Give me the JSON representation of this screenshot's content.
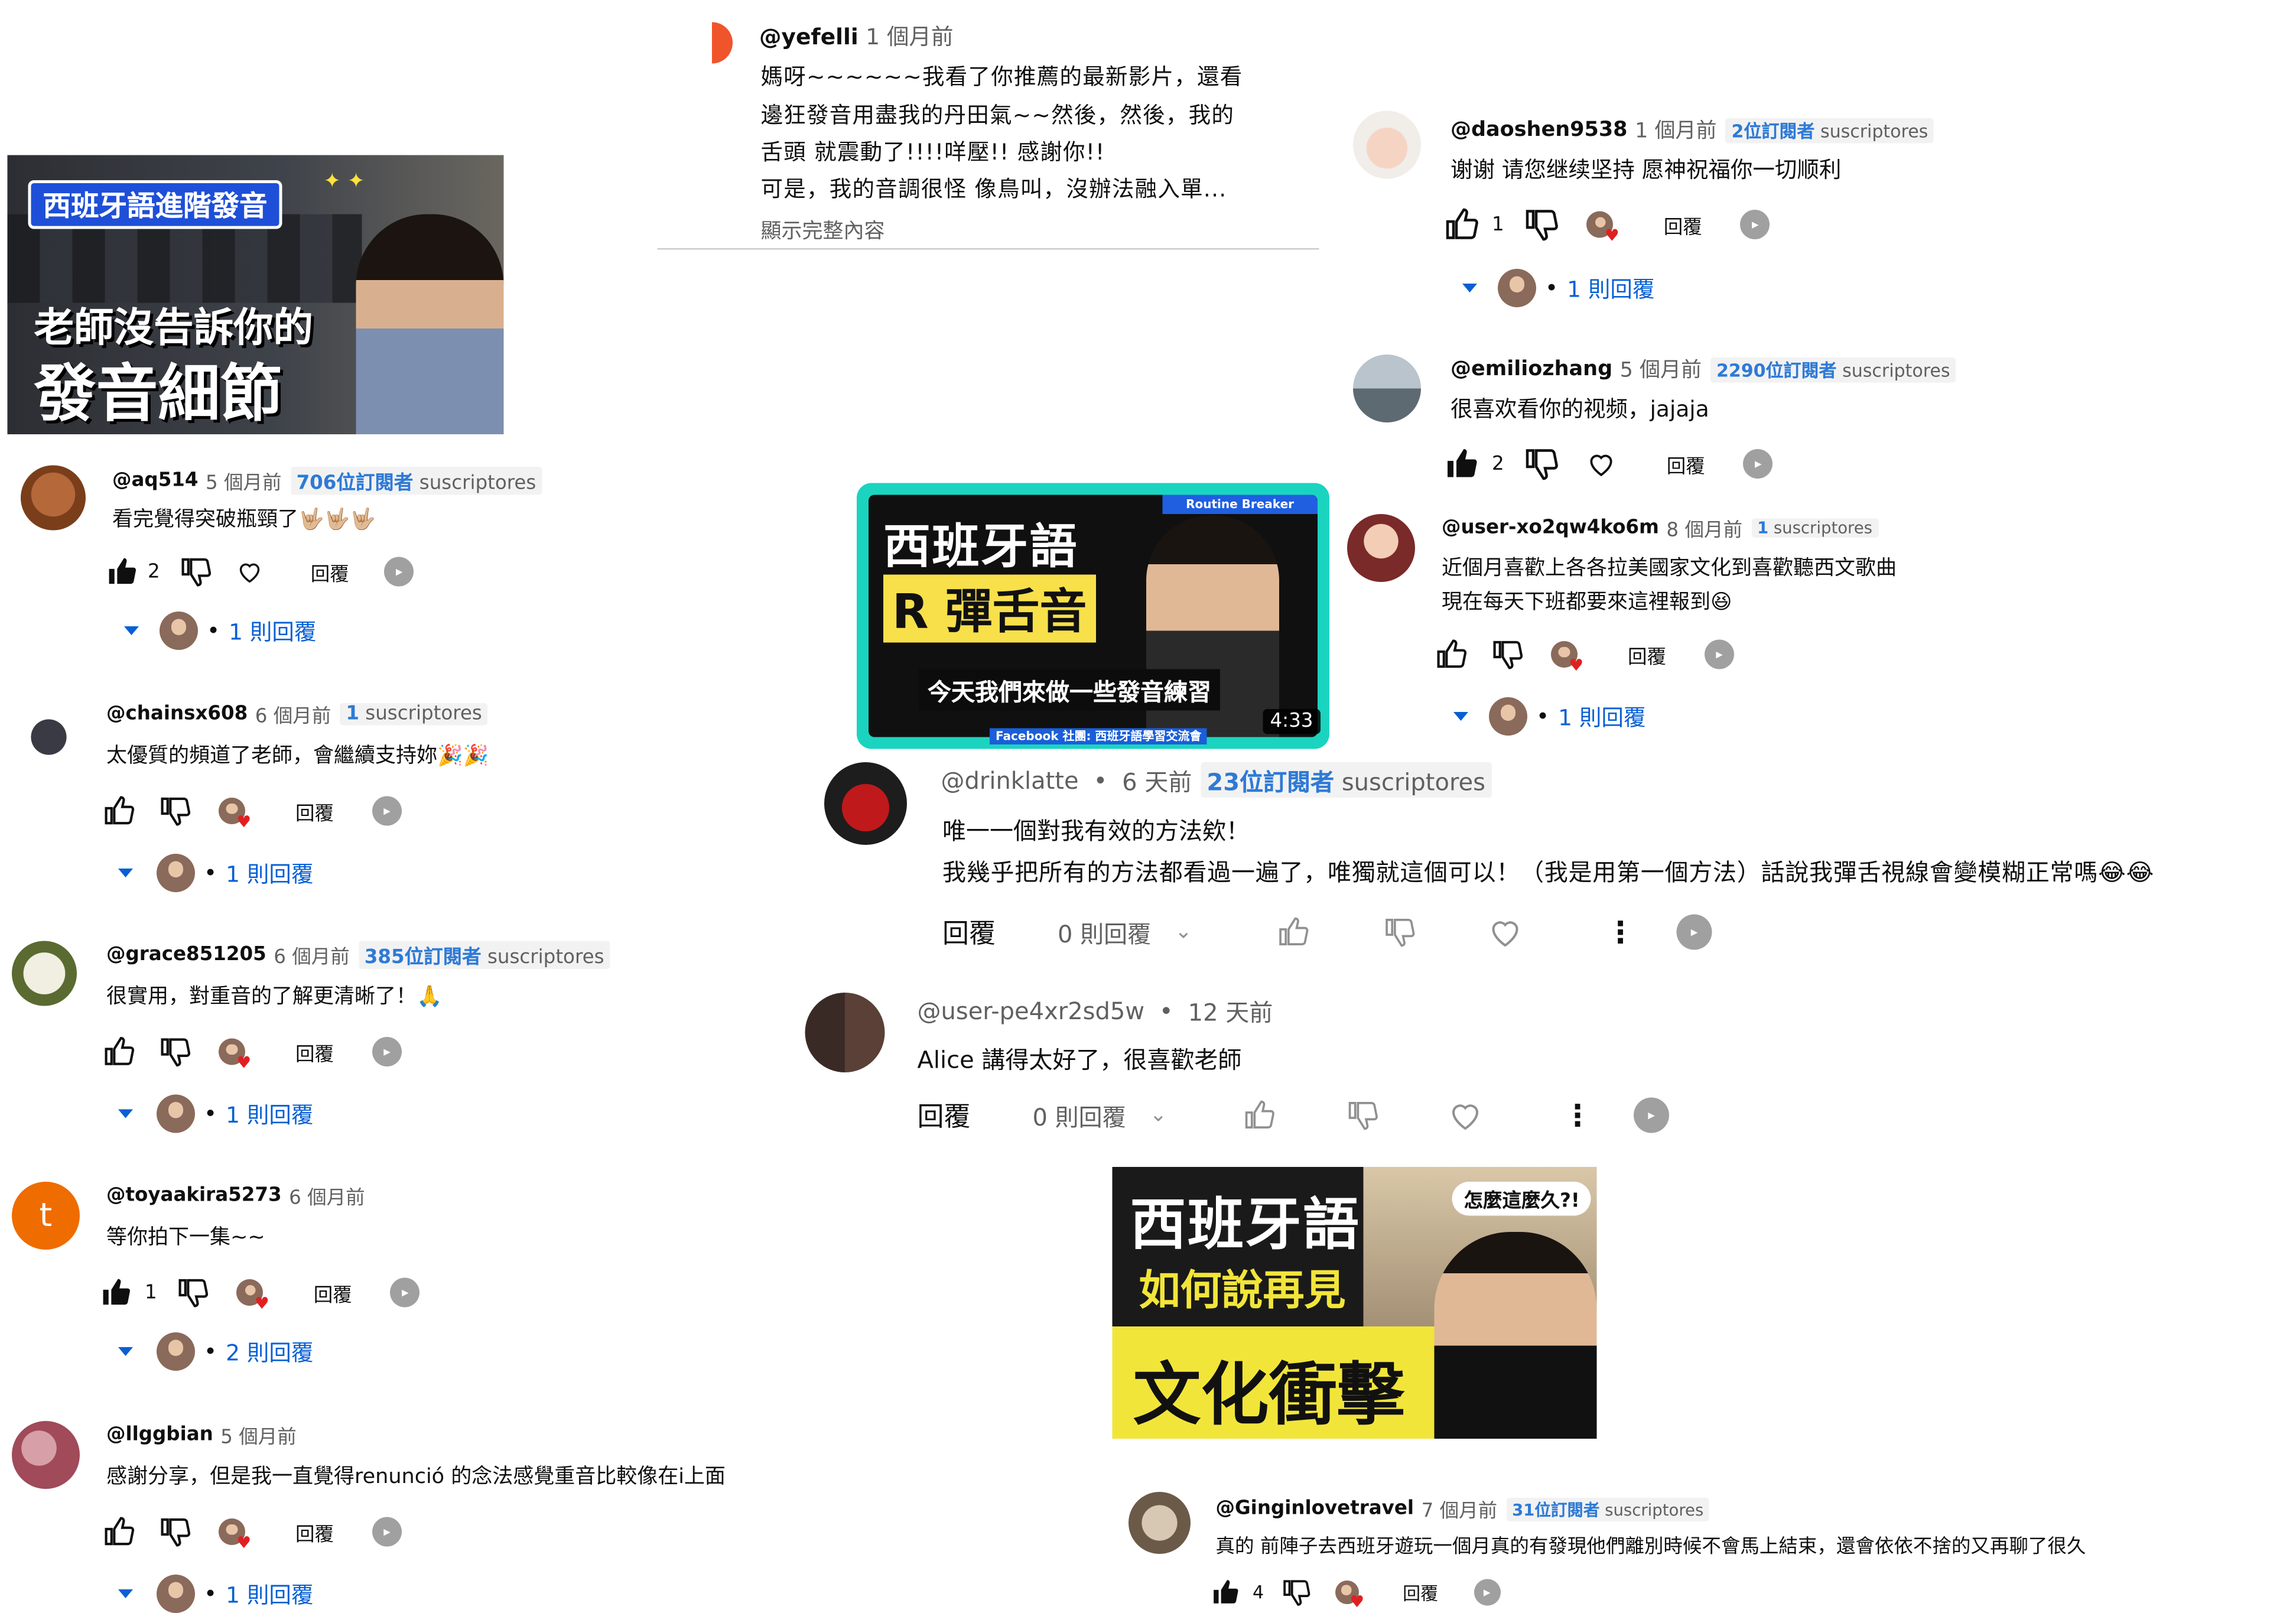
{
  "thumbs": {
    "t1": {
      "tag": "西班牙語進階發音",
      "line1": "老師沒告訴你的",
      "line2": "發音細節"
    },
    "t2": {
      "line1": "西班牙語",
      "line2": "R 彈舌音",
      "top_tag": "Routine Breaker",
      "caption": "今天我們來做一些發音練習",
      "footer": "Facebook 社團: 西班牙語學習交流會",
      "duration": "4:33"
    },
    "t3": {
      "line1": "西班牙語",
      "line2": "如何說再見",
      "line3": "文化衝擊",
      "bubble": "怎麼這麼久?!"
    }
  },
  "show_more": "顯示完整內容",
  "reply_label": "回覆",
  "comments": [
    {
      "id": "yefelli",
      "handle": "@yefelli",
      "time": "1 個月前",
      "lines": [
        "媽呀~~~~~~我看了你推薦的最新影片，還看",
        "邊狂發音用盡我的丹田氣~~然後，然後，我的",
        "舌頭 就震動了!!!!咩壓!! 感謝你!!",
        "可是，我的音調很怪 像鳥叫，沒辦法融入單..."
      ]
    },
    {
      "id": "aq514",
      "handle": "@aq514",
      "time": "5 個月前",
      "badge_num": "706位訂閱者",
      "badge_txt": "suscriptores",
      "text": "看完覺得突破瓶頸了🤟🏼🤟🏼🤟🏼",
      "likes": "2",
      "replies": "1 則回覆"
    },
    {
      "id": "chainsx608",
      "handle": "@chainsx608",
      "time": "6 個月前",
      "badge_num": "1",
      "badge_txt": "suscriptores",
      "text": "太優質的頻道了老師，會繼續支持妳🎉🎉",
      "replies": "1 則回覆"
    },
    {
      "id": "grace851205",
      "handle": "@grace851205",
      "time": "6 個月前",
      "badge_num": "385位訂閱者",
      "badge_txt": "suscriptores",
      "text": "很實用，對重音的了解更清晰了！🙏",
      "replies": "1 則回覆"
    },
    {
      "id": "toyaakira5273",
      "handle": "@toyaakira5273",
      "time": "6 個月前",
      "text": "等你拍下一集~~",
      "likes": "1",
      "replies": "2 則回覆",
      "avatar_letter": "t"
    },
    {
      "id": "llggbian",
      "handle": "@llggbian",
      "time": "5 個月前",
      "text": "感謝分享，但是我一直覺得renunció 的念法感覺重音比較像在i上面",
      "replies": "1 則回覆"
    },
    {
      "id": "daoshen9538",
      "handle": "@daoshen9538",
      "time": "1 個月前",
      "badge_num": "2位訂閱者",
      "badge_txt": "suscriptores",
      "text": "谢谢 请您继续坚持 愿神祝福你一切顺利",
      "likes": "1",
      "replies": "1 則回覆"
    },
    {
      "id": "emiliozhang",
      "handle": "@emiliozhang",
      "time": "5 個月前",
      "badge_num": "2290位訂閱者",
      "badge_txt": "suscriptores",
      "text": "很喜欢看你的视频，jajaja",
      "likes": "2"
    },
    {
      "id": "userxo2",
      "handle": "@user-xo2qw4ko6m",
      "time": "8 個月前",
      "badge_num": "1",
      "badge_txt": "suscriptores",
      "lines": [
        "近個月喜歡上各各拉美國家文化到喜歡聽西文歌曲",
        "現在每天下班都要來這裡報到😆"
      ],
      "replies": "1 則回覆"
    },
    {
      "id": "drinklatte",
      "handle": "@drinklatte",
      "time": "6 天前",
      "badge_num": "23位訂閱者",
      "badge_txt": "suscriptores",
      "lines": [
        "唯一一個對我有效的方法欸！",
        "我幾乎把所有的方法都看過一遍了，唯獨就這個可以！（我是用第一個方法）話說我彈舌視線會變模糊正常嗎😂😂"
      ],
      "reply_count": "0 則回覆"
    },
    {
      "id": "userpe4",
      "handle": "@user-pe4xr2sd5w",
      "time": "12 天前",
      "text": "Alice 講得太好了，很喜歡老師",
      "reply_count": "0 則回覆"
    },
    {
      "id": "ginginlove",
      "handle": "@Ginginlovetravel",
      "time": "7 個月前",
      "badge_num": "31位訂閱者",
      "badge_txt": "suscriptores",
      "text": "真的 前陣子去西班牙遊玩一個月真的有發現他們離別時候不會馬上結束，還會依依不捨的又再聊了很久",
      "likes": "4"
    }
  ],
  "colors": {
    "link": "#065fd4",
    "badge": "#2e7ad6",
    "t1_tag": "#1e4fd8",
    "t2_border": "#1ad4c0",
    "t3_bg": "#f2e53a"
  }
}
